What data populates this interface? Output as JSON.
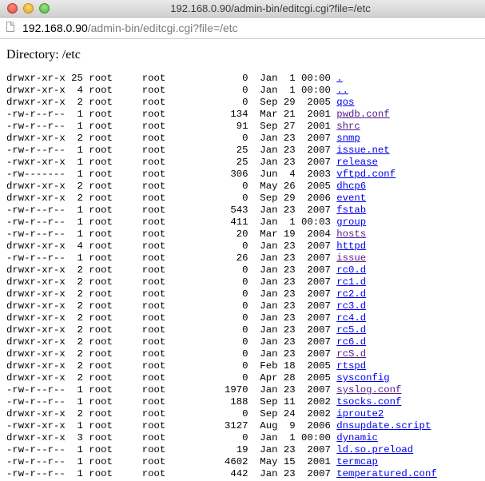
{
  "window": {
    "title": "192.168.0.90/admin-bin/editcgi.cgi?file=/etc"
  },
  "address_bar": {
    "host": "192.168.0.90",
    "path": "/admin-bin/editcgi.cgi?file=/etc"
  },
  "page": {
    "heading": "Directory: /etc"
  },
  "colors": {
    "link": "#0000ee",
    "visited_link": "#551a8b"
  },
  "files": [
    {
      "perms": "drwxr-xr-x",
      "links": "25",
      "owner": "root",
      "group": "root",
      "size": "0",
      "month": "Jan",
      "day": "1",
      "time": "00:00",
      "name": ".",
      "visited": false
    },
    {
      "perms": "drwxr-xr-x",
      "links": "4",
      "owner": "root",
      "group": "root",
      "size": "0",
      "month": "Jan",
      "day": "1",
      "time": "00:00",
      "name": "..",
      "visited": false
    },
    {
      "perms": "drwxr-xr-x",
      "links": "2",
      "owner": "root",
      "group": "root",
      "size": "0",
      "month": "Sep",
      "day": "29",
      "time": "2005",
      "name": "qos",
      "visited": false
    },
    {
      "perms": "-rw-r--r--",
      "links": "1",
      "owner": "root",
      "group": "root",
      "size": "134",
      "month": "Mar",
      "day": "21",
      "time": "2001",
      "name": "pwdb.conf",
      "visited": true
    },
    {
      "perms": "-rw-r--r--",
      "links": "1",
      "owner": "root",
      "group": "root",
      "size": "91",
      "month": "Sep",
      "day": "27",
      "time": "2001",
      "name": "shrc",
      "visited": true
    },
    {
      "perms": "drwxr-xr-x",
      "links": "2",
      "owner": "root",
      "group": "root",
      "size": "0",
      "month": "Jan",
      "day": "23",
      "time": "2007",
      "name": "snmp",
      "visited": false
    },
    {
      "perms": "-rw-r--r--",
      "links": "1",
      "owner": "root",
      "group": "root",
      "size": "25",
      "month": "Jan",
      "day": "23",
      "time": "2007",
      "name": "issue.net",
      "visited": false
    },
    {
      "perms": "-rwxr-xr-x",
      "links": "1",
      "owner": "root",
      "group": "root",
      "size": "25",
      "month": "Jan",
      "day": "23",
      "time": "2007",
      "name": "release",
      "visited": false
    },
    {
      "perms": "-rw-------",
      "links": "1",
      "owner": "root",
      "group": "root",
      "size": "306",
      "month": "Jun",
      "day": "4",
      "time": "2003",
      "name": "vftpd.conf",
      "visited": false
    },
    {
      "perms": "drwxr-xr-x",
      "links": "2",
      "owner": "root",
      "group": "root",
      "size": "0",
      "month": "May",
      "day": "26",
      "time": "2005",
      "name": "dhcp6",
      "visited": false
    },
    {
      "perms": "drwxr-xr-x",
      "links": "2",
      "owner": "root",
      "group": "root",
      "size": "0",
      "month": "Sep",
      "day": "29",
      "time": "2006",
      "name": "event",
      "visited": false
    },
    {
      "perms": "-rw-r--r--",
      "links": "1",
      "owner": "root",
      "group": "root",
      "size": "543",
      "month": "Jan",
      "day": "23",
      "time": "2007",
      "name": "fstab",
      "visited": false
    },
    {
      "perms": "-rw-r--r--",
      "links": "1",
      "owner": "root",
      "group": "root",
      "size": "411",
      "month": "Jan",
      "day": "1",
      "time": "00:03",
      "name": "group",
      "visited": false
    },
    {
      "perms": "-rw-r--r--",
      "links": "1",
      "owner": "root",
      "group": "root",
      "size": "20",
      "month": "Mar",
      "day": "19",
      "time": "2004",
      "name": "hosts",
      "visited": true
    },
    {
      "perms": "drwxr-xr-x",
      "links": "4",
      "owner": "root",
      "group": "root",
      "size": "0",
      "month": "Jan",
      "day": "23",
      "time": "2007",
      "name": "httpd",
      "visited": false
    },
    {
      "perms": "-rw-r--r--",
      "links": "1",
      "owner": "root",
      "group": "root",
      "size": "26",
      "month": "Jan",
      "day": "23",
      "time": "2007",
      "name": "issue",
      "visited": true
    },
    {
      "perms": "drwxr-xr-x",
      "links": "2",
      "owner": "root",
      "group": "root",
      "size": "0",
      "month": "Jan",
      "day": "23",
      "time": "2007",
      "name": "rc0.d",
      "visited": false
    },
    {
      "perms": "drwxr-xr-x",
      "links": "2",
      "owner": "root",
      "group": "root",
      "size": "0",
      "month": "Jan",
      "day": "23",
      "time": "2007",
      "name": "rc1.d",
      "visited": false
    },
    {
      "perms": "drwxr-xr-x",
      "links": "2",
      "owner": "root",
      "group": "root",
      "size": "0",
      "month": "Jan",
      "day": "23",
      "time": "2007",
      "name": "rc2.d",
      "visited": false
    },
    {
      "perms": "drwxr-xr-x",
      "links": "2",
      "owner": "root",
      "group": "root",
      "size": "0",
      "month": "Jan",
      "day": "23",
      "time": "2007",
      "name": "rc3.d",
      "visited": false
    },
    {
      "perms": "drwxr-xr-x",
      "links": "2",
      "owner": "root",
      "group": "root",
      "size": "0",
      "month": "Jan",
      "day": "23",
      "time": "2007",
      "name": "rc4.d",
      "visited": false
    },
    {
      "perms": "drwxr-xr-x",
      "links": "2",
      "owner": "root",
      "group": "root",
      "size": "0",
      "month": "Jan",
      "day": "23",
      "time": "2007",
      "name": "rc5.d",
      "visited": false
    },
    {
      "perms": "drwxr-xr-x",
      "links": "2",
      "owner": "root",
      "group": "root",
      "size": "0",
      "month": "Jan",
      "day": "23",
      "time": "2007",
      "name": "rc6.d",
      "visited": false
    },
    {
      "perms": "drwxr-xr-x",
      "links": "2",
      "owner": "root",
      "group": "root",
      "size": "0",
      "month": "Jan",
      "day": "23",
      "time": "2007",
      "name": "rcS.d",
      "visited": true
    },
    {
      "perms": "drwxr-xr-x",
      "links": "2",
      "owner": "root",
      "group": "root",
      "size": "0",
      "month": "Feb",
      "day": "18",
      "time": "2005",
      "name": "rtspd",
      "visited": false
    },
    {
      "perms": "drwxr-xr-x",
      "links": "2",
      "owner": "root",
      "group": "root",
      "size": "0",
      "month": "Apr",
      "day": "28",
      "time": "2005",
      "name": "sysconfig",
      "visited": false
    },
    {
      "perms": "-rw-r--r--",
      "links": "1",
      "owner": "root",
      "group": "root",
      "size": "1970",
      "month": "Jan",
      "day": "23",
      "time": "2007",
      "name": "syslog.conf",
      "visited": true
    },
    {
      "perms": "-rw-r--r--",
      "links": "1",
      "owner": "root",
      "group": "root",
      "size": "188",
      "month": "Sep",
      "day": "11",
      "time": "2002",
      "name": "tsocks.conf",
      "visited": false
    },
    {
      "perms": "drwxr-xr-x",
      "links": "2",
      "owner": "root",
      "group": "root",
      "size": "0",
      "month": "Sep",
      "day": "24",
      "time": "2002",
      "name": "iproute2",
      "visited": false
    },
    {
      "perms": "-rwxr-xr-x",
      "links": "1",
      "owner": "root",
      "group": "root",
      "size": "3127",
      "month": "Aug",
      "day": "9",
      "time": "2006",
      "name": "dnsupdate.script",
      "visited": false
    },
    {
      "perms": "drwxr-xr-x",
      "links": "3",
      "owner": "root",
      "group": "root",
      "size": "0",
      "month": "Jan",
      "day": "1",
      "time": "00:00",
      "name": "dynamic",
      "visited": false
    },
    {
      "perms": "-rw-r--r--",
      "links": "1",
      "owner": "root",
      "group": "root",
      "size": "19",
      "month": "Jan",
      "day": "23",
      "time": "2007",
      "name": "ld.so.preload",
      "visited": false
    },
    {
      "perms": "-rw-r--r--",
      "links": "1",
      "owner": "root",
      "group": "root",
      "size": "4602",
      "month": "May",
      "day": "15",
      "time": "2001",
      "name": "termcap",
      "visited": false
    },
    {
      "perms": "-rw-r--r--",
      "links": "1",
      "owner": "root",
      "group": "root",
      "size": "442",
      "month": "Jan",
      "day": "23",
      "time": "2007",
      "name": "temperatured.conf",
      "visited": false
    }
  ]
}
